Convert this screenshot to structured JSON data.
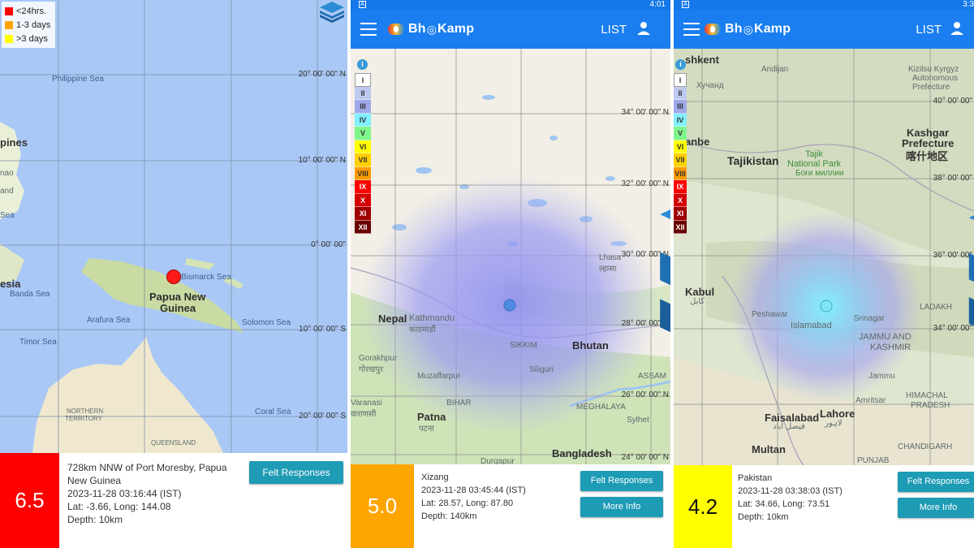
{
  "colors": {
    "sea": "#a9c8f5",
    "land": "#f2efe6",
    "appbar": "#1a7ef0",
    "statusbar": "#1578e8",
    "button": "#1e9bb5",
    "mag_red": "#ff0000",
    "mag_orange": "#ffa500",
    "mag_yellow": "#ffff00"
  },
  "app": {
    "logo_text_1": "Bh",
    "logo_text_2": "Kamp",
    "list_label": "LIST"
  },
  "legend_recency": [
    {
      "label": "<24hrs.",
      "color": "#ff0000"
    },
    {
      "label": "1-3 days",
      "color": "#ffa500"
    },
    {
      "label": ">3 days",
      "color": "#ffff00"
    }
  ],
  "mmi_scale": [
    {
      "label": "I",
      "color": "#ffffff",
      "text": "#333"
    },
    {
      "label": "II",
      "color": "#bfc8f0",
      "text": "#333"
    },
    {
      "label": "III",
      "color": "#9fa8e8",
      "text": "#333"
    },
    {
      "label": "IV",
      "color": "#7ff0ff",
      "text": "#333"
    },
    {
      "label": "V",
      "color": "#7ff58a",
      "text": "#333"
    },
    {
      "label": "VI",
      "color": "#ffff00",
      "text": "#333"
    },
    {
      "label": "VII",
      "color": "#ffd000",
      "text": "#333"
    },
    {
      "label": "VIII",
      "color": "#ff9a00",
      "text": "#333"
    },
    {
      "label": "IX",
      "color": "#ff0000",
      "text": "#fff"
    },
    {
      "label": "X",
      "color": "#d50000",
      "text": "#fff"
    },
    {
      "label": "XI",
      "color": "#a00000",
      "text": "#fff"
    },
    {
      "label": "XII",
      "color": "#6a0000",
      "text": "#fff"
    }
  ],
  "panels": [
    {
      "map_labels": [
        {
          "t": "Philippine Sea",
          "c": "sea"
        },
        {
          "t": "pines",
          "c": "big"
        },
        {
          "t": "nao",
          "c": ""
        },
        {
          "t": "and",
          "c": ""
        },
        {
          "t": "Sea",
          "c": "sea"
        },
        {
          "t": "Bismarck Sea",
          "c": "sea"
        },
        {
          "t": "Papua New",
          "c": "country"
        },
        {
          "t": "Guinea",
          "c": "country"
        },
        {
          "t": "esia",
          "c": "big"
        },
        {
          "t": "Banda Sea",
          "c": "sea"
        },
        {
          "t": "Arafura Sea",
          "c": "sea"
        },
        {
          "t": "Solomon Sea",
          "c": "sea"
        },
        {
          "t": "Timor Sea",
          "c": "sea"
        },
        {
          "t": "Coral Sea",
          "c": "sea"
        },
        {
          "t": "NORTHERN",
          "c": ""
        },
        {
          "t": "TERRITORY",
          "c": ""
        },
        {
          "t": "QUEENSLAND",
          "c": ""
        }
      ],
      "coords": [
        "20° 00' 00\" N",
        "10° 00' 00\" N",
        "0° 00' 00\"",
        "10° 00' 00\" S",
        "20° 00' 00\" S"
      ],
      "magnitude": "6.5",
      "location_line1": "728km NNW of Port Moresby, Papua",
      "location_line2": "New Guinea",
      "datetime": "2023-11-28 03:16:44 (IST)",
      "latlong": "Lat: -3.66, Long: 144.08",
      "depth": "Depth: 10km",
      "felt_label": "Felt Responses"
    },
    {
      "time": "4:01",
      "map_labels": [
        {
          "t": "Lhasa",
          "c": ""
        },
        {
          "t": "ल्हासा",
          "c": ""
        },
        {
          "t": "Nepal",
          "c": "country"
        },
        {
          "t": "Kathmandu",
          "c": ""
        },
        {
          "t": "काठमाडौं",
          "c": ""
        },
        {
          "t": "SIKKIM",
          "c": ""
        },
        {
          "t": "Bhutan",
          "c": "country"
        },
        {
          "t": "Siliguri",
          "c": ""
        },
        {
          "t": "Gorakhpur",
          "c": ""
        },
        {
          "t": "गोरखपुर",
          "c": ""
        },
        {
          "t": "Muzaffarpur",
          "c": ""
        },
        {
          "t": "ASSAM",
          "c": ""
        },
        {
          "t": "Varanasi",
          "c": ""
        },
        {
          "t": "वाराणसी",
          "c": ""
        },
        {
          "t": "BIHAR",
          "c": ""
        },
        {
          "t": "MEGHALAYA",
          "c": ""
        },
        {
          "t": "Sylhet",
          "c": ""
        },
        {
          "t": "Patna",
          "c": "big"
        },
        {
          "t": "पटना",
          "c": ""
        },
        {
          "t": "Bangladesh",
          "c": "country"
        },
        {
          "t": "Durgapur",
          "c": ""
        }
      ],
      "coords": [
        "34° 00' 00\" N",
        "32° 00' 00\" N",
        "30° 00' 00\" N",
        "28° 00' 00\" N",
        "26° 00' 00\" N",
        "24° 00' 00\" N"
      ],
      "magnitude": "5.0",
      "location_line1": "Xizang",
      "datetime": "2023-11-28 03:45:44 (IST)",
      "latlong": "Lat: 28.57, Long: 87.80",
      "depth": "Depth: 140km",
      "felt_label": "Felt Responses",
      "more_label": "More Info"
    },
    {
      "time": "3:3",
      "map_labels": [
        {
          "t": "shkent",
          "c": "big"
        },
        {
          "t": "Andijan",
          "c": ""
        },
        {
          "t": "Kizilsu Kyrgyz",
          "c": ""
        },
        {
          "t": "Autonomous",
          "c": ""
        },
        {
          "t": "Prefecture",
          "c": ""
        },
        {
          "t": "Хучанд",
          "c": ""
        },
        {
          "t": "Kashgar",
          "c": "big"
        },
        {
          "t": "Prefecture",
          "c": "big"
        },
        {
          "t": "喀什地区",
          "c": "big"
        },
        {
          "t": "anbe",
          "c": "big"
        },
        {
          "t": "Tajikistan",
          "c": "country"
        },
        {
          "t": "Tajik",
          "c": ""
        },
        {
          "t": "National Park",
          "c": ""
        },
        {
          "t": "Боғи миллии",
          "c": ""
        },
        {
          "t": "Kabul",
          "c": "big"
        },
        {
          "t": "کابل",
          "c": ""
        },
        {
          "t": "Peshawar",
          "c": ""
        },
        {
          "t": "Islamabad",
          "c": ""
        },
        {
          "t": "Srinagar",
          "c": ""
        },
        {
          "t": "LADAKH",
          "c": ""
        },
        {
          "t": "JAMMU AND",
          "c": ""
        },
        {
          "t": "KASHMIR",
          "c": ""
        },
        {
          "t": "Jammu",
          "c": ""
        },
        {
          "t": "Amritsar",
          "c": ""
        },
        {
          "t": "HIMACHAL",
          "c": ""
        },
        {
          "t": "PRADESH",
          "c": ""
        },
        {
          "t": "Faisalabad",
          "c": "big"
        },
        {
          "t": "فیصل آباد",
          "c": ""
        },
        {
          "t": "Lahore",
          "c": "big"
        },
        {
          "t": "لاہور",
          "c": ""
        },
        {
          "t": "Multan",
          "c": "big"
        },
        {
          "t": "CHANDIGARH",
          "c": ""
        },
        {
          "t": "PUNJAB",
          "c": ""
        }
      ],
      "coords": [
        "40° 00' 00\"",
        "38° 00' 00\"",
        "36° 00' 00\"",
        "34° 00' 00\""
      ],
      "magnitude": "4.2",
      "location_line1": "Pakistan",
      "datetime": "2023-11-28 03:38:03 (IST)",
      "latlong": "Lat: 34.66, Long: 73.51",
      "depth": "Depth: 10km",
      "felt_label": "Felt Responses",
      "more_label": "More Info"
    }
  ]
}
